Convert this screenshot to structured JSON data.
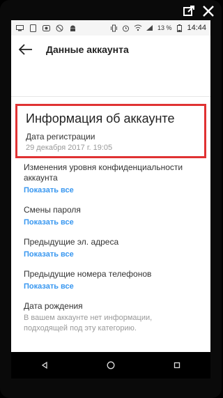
{
  "status_bar": {
    "battery": "13 %",
    "time": "14:44"
  },
  "header": {
    "title": "Данные аккаунта"
  },
  "section": {
    "title": "Информация об аккаунте",
    "registration": {
      "label": "Дата регистрации",
      "value": "29 декабря 2017 г. 19:05"
    }
  },
  "items": [
    {
      "label": "Изменения уровня конфиденциальности аккаунта",
      "link": "Показать все"
    },
    {
      "label": "Смены пароля",
      "link": "Показать все"
    },
    {
      "label": "Предыдущие эл. адреса",
      "link": "Показать все"
    },
    {
      "label": "Предыдущие номера телефонов",
      "link": "Показать все"
    }
  ],
  "birthday": {
    "label": "Дата рождения",
    "desc": "В вашем аккаунте нет информации, подходящей под эту категорию."
  }
}
